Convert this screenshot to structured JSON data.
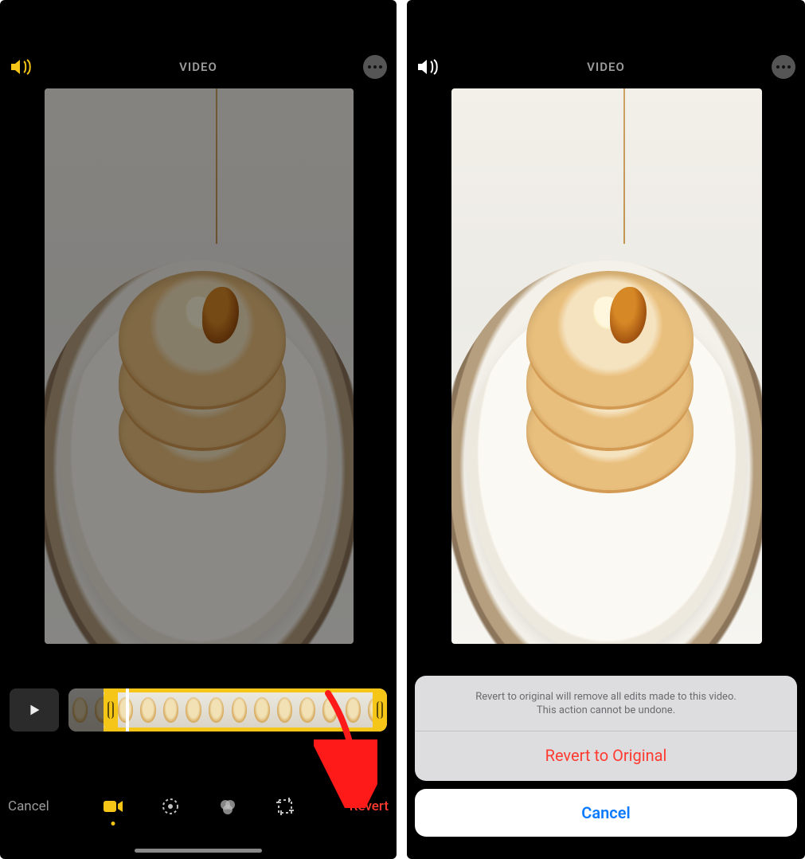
{
  "left": {
    "topbar": {
      "title": "VIDEO"
    },
    "toolbar": {
      "cancel": "Cancel",
      "revert": "Revert",
      "tabs": [
        "video",
        "adjust",
        "filters",
        "crop"
      ],
      "active_tab_index": 0
    },
    "timeline": {
      "frame_count": 14
    }
  },
  "right": {
    "topbar": {
      "title": "VIDEO"
    },
    "sheet": {
      "message_line1": "Revert to original will remove all edits made to this video.",
      "message_line2": "This action cannot be undone.",
      "destructive": "Revert to Original",
      "cancel": "Cancel"
    }
  },
  "annotation": {
    "arrow_color": "#ff1a1a"
  }
}
